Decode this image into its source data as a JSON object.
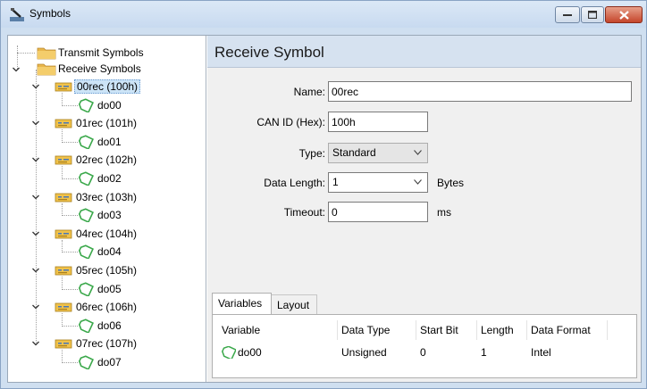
{
  "window": {
    "title": "Symbols",
    "app_icon": "symbols-app-icon"
  },
  "tree": {
    "transmit_label": "Transmit Symbols",
    "receive_label": "Receive Symbols",
    "messages": [
      {
        "label": "00rec (100h)",
        "child": "do00"
      },
      {
        "label": "01rec (101h)",
        "child": "do01"
      },
      {
        "label": "02rec (102h)",
        "child": "do02"
      },
      {
        "label": "03rec (103h)",
        "child": "do03"
      },
      {
        "label": "04rec (104h)",
        "child": "do04"
      },
      {
        "label": "05rec (105h)",
        "child": "do05"
      },
      {
        "label": "06rec (106h)",
        "child": "do06"
      },
      {
        "label": "07rec (107h)",
        "child": "do07"
      }
    ],
    "selected_index": 0
  },
  "panel": {
    "title": "Receive Symbol",
    "name_label": "Name:",
    "name_value": "00rec",
    "canid_label": "CAN ID (Hex):",
    "canid_value": "100h",
    "type_label": "Type:",
    "type_value": "Standard",
    "datalen_label": "Data Length:",
    "datalen_value": "1",
    "datalen_unit": "Bytes",
    "timeout_label": "Timeout:",
    "timeout_value": "0",
    "timeout_unit": "ms"
  },
  "tabs": {
    "variables": "Variables",
    "layout": "Layout",
    "active": "variables"
  },
  "grid": {
    "columns": [
      "Variable",
      "Data Type",
      "Start Bit",
      "Length",
      "Data Format"
    ],
    "rows": [
      {
        "variable": "do00",
        "data_type": "Unsigned",
        "start_bit": "0",
        "length": "1",
        "data_format": "Intel"
      }
    ]
  },
  "colors": {
    "accent": "#cce4f7",
    "panel_header": "#d6e2f0",
    "tag_icon": "#3aa84a",
    "folder": "#e8b64c"
  }
}
